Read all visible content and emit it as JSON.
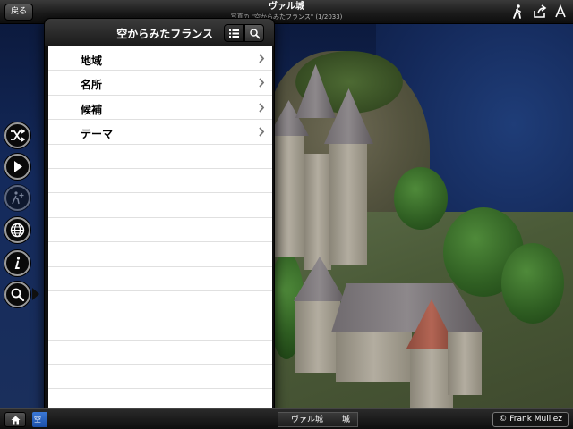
{
  "topbar": {
    "back_label": "戻る",
    "title": "ヴァル城",
    "subtitle": "写真の \"空からみたフランス\" (1/2033)",
    "icons": [
      "walk-icon",
      "share-icon",
      "text-size-icon"
    ]
  },
  "sidebar": {
    "buttons": [
      {
        "name": "shuffle-icon"
      },
      {
        "name": "play-icon"
      },
      {
        "name": "walk-plus-icon"
      },
      {
        "name": "globe-icon"
      },
      {
        "name": "info-icon"
      },
      {
        "name": "search-icon"
      }
    ]
  },
  "popover": {
    "title": "空からみたフランス",
    "segment_icons": [
      "list-icon",
      "search-icon"
    ],
    "items": [
      {
        "label": "地域"
      },
      {
        "label": "名所"
      },
      {
        "label": "候補"
      },
      {
        "label": "テーマ"
      }
    ],
    "empty_rows": 11
  },
  "bottombar": {
    "active_crumb": "空",
    "crumbs": [
      "ヴァル城",
      "城"
    ],
    "credit": "Frank Mulliez",
    "credit_symbol": "©"
  },
  "colors": {
    "accent_blue": "#2a65c4",
    "bar_dark": "#1c1c1c",
    "list_bg": "#ffffff"
  }
}
